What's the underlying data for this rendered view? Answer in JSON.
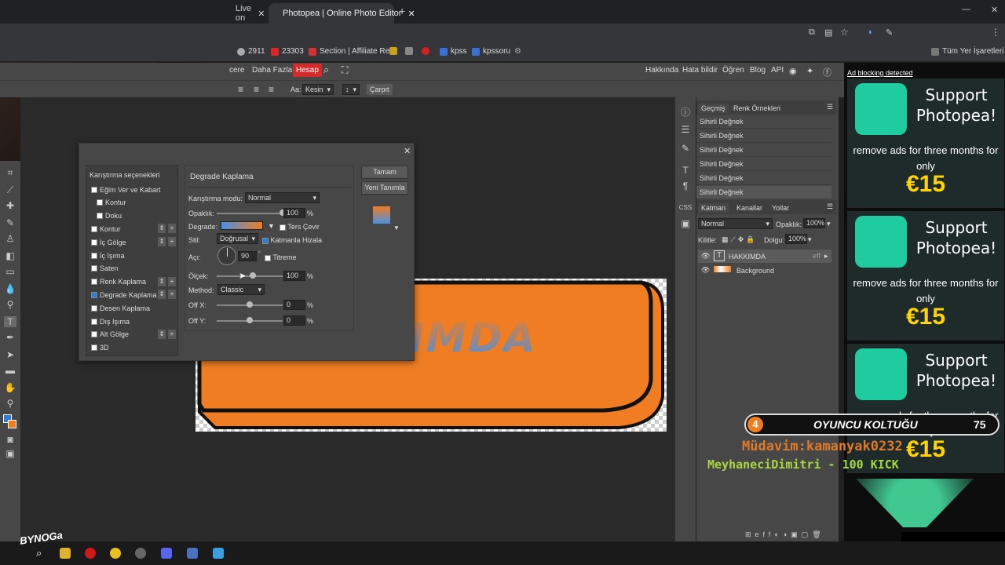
{
  "browser": {
    "tabs": [
      {
        "label": "Live on",
        "active": false
      },
      {
        "label": "Photopea | Online Photo Editor",
        "active": true
      }
    ],
    "bookmarks": [
      {
        "label": "2911",
        "color": "#aaaaaa"
      },
      {
        "label": "23303",
        "color": "#e02424"
      },
      {
        "label": "Section | Affiliate Re...",
        "color": "#d63030"
      },
      {
        "label": "kpss",
        "color": "#3a6ed8"
      },
      {
        "label": "kpssoru",
        "color": "#3a6ed8"
      }
    ],
    "all_bookmarks_label": "Tüm Yer İşaretleri"
  },
  "app": {
    "menu": [
      "cere",
      "Daha Fazla",
      "Hesap"
    ],
    "help_menu": [
      "Hakkında",
      "Hata bildir",
      "Öğren",
      "Blog",
      "API"
    ],
    "options": {
      "aa_label": "Aa:",
      "aa_value": "Kesin",
      "deform_label": "Çarpıt"
    }
  },
  "dialog": {
    "styles_title": "Karıştırma seçenekleri",
    "styles": [
      {
        "label": "Eğim Ver ve Kabart",
        "checked": false,
        "sub": false,
        "plus": false
      },
      {
        "label": "Kontur",
        "checked": false,
        "sub": true,
        "plus": false
      },
      {
        "label": "Doku",
        "checked": false,
        "sub": true,
        "plus": false
      },
      {
        "label": "Kontur",
        "checked": false,
        "sub": false,
        "plus": true
      },
      {
        "label": "İç Gölge",
        "checked": false,
        "sub": false,
        "plus": true
      },
      {
        "label": "İç Işıma",
        "checked": false,
        "sub": false,
        "plus": false
      },
      {
        "label": "Saten",
        "checked": false,
        "sub": false,
        "plus": false
      },
      {
        "label": "Renk Kaplama",
        "checked": false,
        "sub": false,
        "plus": true
      },
      {
        "label": "Degrade Kaplama",
        "checked": true,
        "sub": false,
        "plus": true
      },
      {
        "label": "Desen Kaplama",
        "checked": false,
        "sub": false,
        "plus": false
      },
      {
        "label": "Dış Işıma",
        "checked": false,
        "sub": false,
        "plus": false
      },
      {
        "label": "Alt Gölge",
        "checked": false,
        "sub": false,
        "plus": true
      },
      {
        "label": "3D",
        "checked": false,
        "sub": false,
        "plus": false
      }
    ],
    "section_title": "Degrade Kaplama",
    "blend_mode_label": "Karıştırma modu:",
    "blend_mode_value": "Normal",
    "opacity_label": "Opaklık:",
    "opacity_value": "100",
    "opacity_fraction": 1.0,
    "gradient_label": "Degrade:",
    "reverse_label": "Ters Çevir",
    "style_label": "Stil:",
    "style_value": "Doğrusal",
    "align_label": "Katmanla Hizala",
    "angle_label": "Açı:",
    "angle_value": "90",
    "dither_label": "Titreme",
    "scale_label": "Ölçek:",
    "scale_value": "100",
    "scale_fraction": 0.55,
    "method_label": "Method:",
    "method_value": "Classic",
    "offx_label": "Off X:",
    "offx_value": "0",
    "offy_label": "Off Y:",
    "offy_value": "0",
    "percent": "%",
    "ok_label": "Tamam",
    "new_label": "Yeni Tanımla",
    "gradient_colors": [
      "#4a90e2",
      "#f07d22"
    ]
  },
  "canvas_text": "IMDA",
  "history": {
    "tabs": [
      "Geçmiş",
      "Renk Örnekleri"
    ],
    "items": [
      "Sihirli Değnek",
      "Sihirli Değnek",
      "Sihirli Değnek",
      "Sihirli Değnek",
      "Sihirli Değnek",
      "Sihirli Değnek"
    ]
  },
  "layers": {
    "tabs": [
      "Katman",
      "Kanallar",
      "Yollar"
    ],
    "blend": "Normal",
    "opacity_label": "Opaklık:",
    "opacity_value": "100%",
    "lock_label": "Kilitle:",
    "fill_label": "Dolgu:",
    "fill_value": "100%",
    "items": [
      {
        "name": "HAKKIMDA",
        "type": "text"
      },
      {
        "name": "Background",
        "type": "image"
      }
    ]
  },
  "ads": {
    "blocking": "Ad blocking detected",
    "title": "Support Photopea!",
    "sub": "remove ads for three months for only",
    "price": "€15"
  },
  "overlay": {
    "rank": "4",
    "seat": "OYUNCU KOLTUĞU",
    "score": "75",
    "ticker1": "Müdavim:kamanyak0232",
    "ticker2": "MeyhaneciDimitri - 100 KICK",
    "brand": "section",
    "streamer_logo": "BYNOGa"
  }
}
